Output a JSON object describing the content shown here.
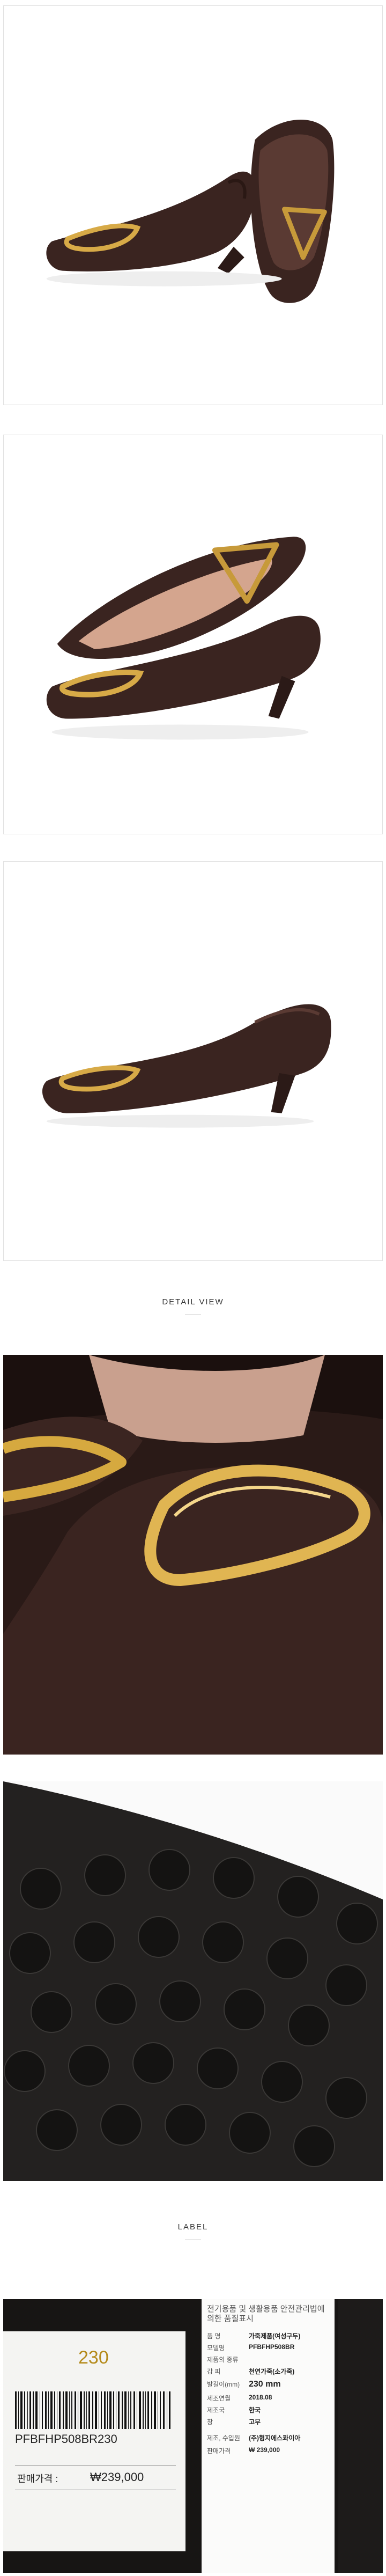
{
  "sections": {
    "detail_view": "DETAIL VIEW",
    "label": "LABEL"
  },
  "label_tag": {
    "size": "230",
    "barcode_code": "PFBFHP508BR230",
    "price_label": "판매가격 :",
    "price_value": "₩239,000"
  },
  "info_card": {
    "title": "전기용품 및 생활용품 안전관리법에 의한 품질표시",
    "rows": [
      {
        "k": "품  명",
        "v": "가죽제품(여성구두)"
      },
      {
        "k": "모델명",
        "v": "PFBFHP508BR"
      },
      {
        "k": "제품의 종류",
        "v": ""
      },
      {
        "k": "갑  피",
        "v": "천연가죽(소가죽)"
      },
      {
        "k": "발길이(mm)",
        "v": "230 mm"
      },
      {
        "k": "제조연월",
        "v": "2018.08"
      },
      {
        "k": "제조국",
        "v": "한국"
      },
      {
        "k": "창",
        "v": "고무"
      },
      {
        "k": "제조, 수입원",
        "v": "(주)형지에스콰이아"
      },
      {
        "k": "판매가격",
        "v": "₩ 239,000"
      }
    ]
  },
  "colors": {
    "leather": "#3a2420",
    "gold": "#c79a3a",
    "label_size": "#b58b1c"
  }
}
